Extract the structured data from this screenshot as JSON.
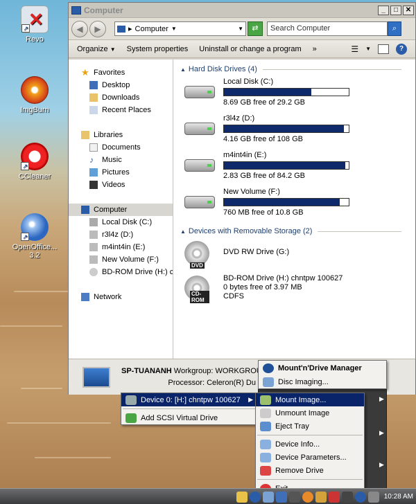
{
  "desktop": {
    "icons": [
      {
        "label": "Revo",
        "icon": "revo-uninstaller-icon"
      },
      {
        "label": "ImgBurn",
        "icon": "imgburn-disc-icon"
      },
      {
        "label": "CCleaner",
        "icon": "ccleaner-icon"
      },
      {
        "label": "OpenOffice...",
        "sublabel": "3.2",
        "icon": "openoffice-gull-icon"
      }
    ]
  },
  "window": {
    "title": "Computer",
    "address": "Computer",
    "search_placeholder": "Search Computer",
    "toolbar": {
      "organize": "Organize",
      "system_properties": "System properties",
      "uninstall": "Uninstall or change a program",
      "more": "»"
    },
    "nav": {
      "favorites": "Favorites",
      "desktop": "Desktop",
      "downloads": "Downloads",
      "recent": "Recent Places",
      "libraries": "Libraries",
      "documents": "Documents",
      "music": "Music",
      "pictures": "Pictures",
      "videos": "Videos",
      "computer": "Computer",
      "local_disk": "Local Disk (C:)",
      "r3l4z": "r3l4z (D:)",
      "m4int4in": "m4int4in (E:)",
      "new_volume": "New Volume (F:)",
      "bdrom": "BD-ROM Drive (H:) chnt",
      "network": "Network"
    },
    "groups": {
      "hdd": "Hard Disk Drives (4)",
      "removable": "Devices with Removable Storage (2)"
    },
    "drives": [
      {
        "name": "Local Disk (C:)",
        "free": "8.69 GB free of 29.2 GB",
        "used_fraction": 0.7
      },
      {
        "name": "r3l4z (D:)",
        "free": "4.16 GB free of 108 GB",
        "used_fraction": 0.96
      },
      {
        "name": "m4int4in (E:)",
        "free": "2.83 GB free of 84.2 GB",
        "used_fraction": 0.97
      },
      {
        "name": "New Volume (F:)",
        "free": "760 MB free of 10.8 GB",
        "used_fraction": 0.93
      }
    ],
    "removable": {
      "dvd": "DVD RW Drive (G:)",
      "dvd_tag": "DVD",
      "bd_name": "BD-ROM Drive (H:) chntpw 100627",
      "bd_free": "0 bytes free of 3.97 MB",
      "bd_fs": "CDFS",
      "bd_tag": "CD-ROM"
    },
    "details": {
      "computer_name": "SP-TUANANH",
      "workgroup_label": "Workgroup:",
      "workgroup_value": "WORKGROUP",
      "processor_label": "Processor:",
      "processor_value": "Celeron(R) Du"
    }
  },
  "device_menu": {
    "device": "Device 0: [H:] chntpw 100627",
    "add_scsi": "Add SCSI Virtual Drive"
  },
  "app_menu": {
    "title": "Mount'n'Drive Manager",
    "disc_imaging": "Disc Imaging..."
  },
  "action_menu": {
    "mount": "Mount Image...",
    "unmount": "Unmount Image",
    "eject": "Eject Tray",
    "info": "Device Info...",
    "params": "Device Parameters...",
    "remove": "Remove Drive",
    "exit": "Exit"
  },
  "taskbar": {
    "clock": "10:28 AM"
  }
}
